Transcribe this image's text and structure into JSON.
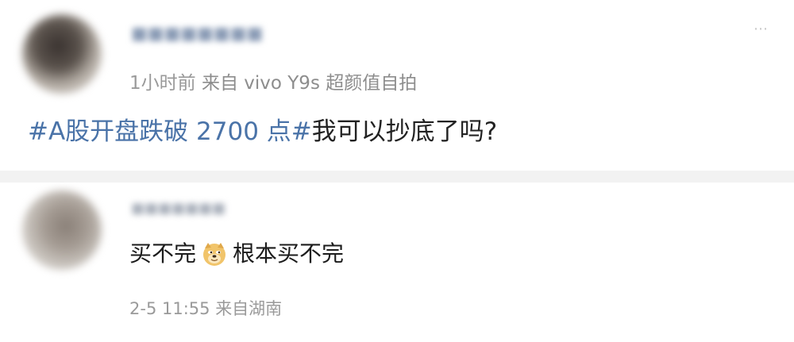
{
  "post": {
    "meta_time": "1小时前",
    "meta_source": "来自 vivo Y9s 超颜值自拍",
    "hashtag": "#A股开盘跌破 2700 点#",
    "text": "我可以抄底了吗?"
  },
  "comment": {
    "text_before_emoji": "买不完",
    "emoji": "doge-emoji",
    "text_after_emoji": "根本买不完",
    "meta_time": "2-5 11:55",
    "meta_source": "来自湖南"
  },
  "colors": {
    "hashtag": "#4a73a8",
    "meta": "#9a9a9a",
    "text": "#222222",
    "divider": "#f2f2f2"
  }
}
